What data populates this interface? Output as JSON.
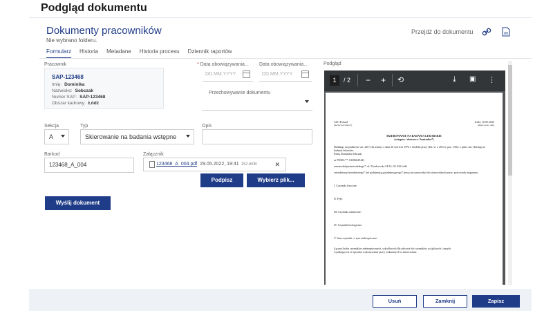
{
  "page": {
    "title": "Podgląd dokumentu"
  },
  "card": {
    "title": "Dokumenty pracowników",
    "subtitle": "Nie wybrano folderu.",
    "goto_label": "Przejdź do dokumentu"
  },
  "tabs": [
    {
      "label": "Formularz",
      "active": true
    },
    {
      "label": "Historia"
    },
    {
      "label": "Metadane"
    },
    {
      "label": "Historia procesu"
    },
    {
      "label": "Dziennik raportów"
    }
  ],
  "form": {
    "employee_label": "Pracownik",
    "employee": {
      "id": "SAP-123468",
      "rows": [
        {
          "label": "Imię:",
          "value": "Dominika"
        },
        {
          "label": "Nazwisko:",
          "value": "Sobczak"
        },
        {
          "label": "Numer SAP:",
          "value": "SAP-123468"
        },
        {
          "label": "Obszar kadrowy:",
          "value": "Łódź"
        }
      ]
    },
    "valid_from_label": "Data obowiązywania...",
    "valid_to_label": "Data obowiązywania...",
    "date_placeholder": "DD.MM.YYYY",
    "storage_label": "Przechowywanie dokumentu",
    "storage_value": "",
    "section_label": "Sekcja",
    "section_value": "A",
    "type_label": "Typ",
    "type_value": "Skierowanie na badania wstępne",
    "desc_label": "Opis",
    "desc_value": "",
    "barcode_label": "Barkod",
    "barcode_value": "123468_A_004",
    "attachment_label": "Załącznik",
    "attachment": {
      "file": "123468_A_004.pdf",
      "date": "29.05.2022, 19:41",
      "size": "152.6KB"
    },
    "sign_label": "Podpisz",
    "choose_file_label": "Wybierz plik...",
    "send_label": "Wyślij dokument"
  },
  "preview": {
    "label": "Podgląd",
    "page_current": "1",
    "page_total": "/ 2",
    "doc": {
      "header_left": "ASC Poland",
      "header_left_sub": "(pieczęć pracodawcy)",
      "header_right": "Łódź, 16.05.2022",
      "header_right_sub": "(miejscowość, data)",
      "title": "SKIEROWANIE NA BADANIA LEKARSKIE",
      "title_sub": "(wstępne / okresowe / kontrolne*)",
      "paragraph": "Działając na podstawie art. 229 § 4a ustawy z dnia 26 czerwca 1974 r. Kodeks pracy (Dz. U. z 2014 r. poz. 1502, z późn. zm.) kieruję na badania lekarskie:",
      "person": "Panią Dominika Sobczak",
      "pesel": "nr PESEL**: 81386045441",
      "address": "zamieszkałą/zamieszkałego*: ul. Piotrkowska 54/14, 02-543 Łódź",
      "position": "zatrudnioną/zatrudnionego* lub podejmującą/podejmującego* pracę na stanowisku lub stanowiskach pracy: pracownik magazynu",
      "sections": [
        "I. Czynniki fizyczne:",
        "II. Pyły:",
        "III. Czynniki chemiczne:",
        "IV. Czynniki biologiczne:",
        "V. Inne czynniki, w tym niebezpieczne:"
      ],
      "summary": "Łączna liczba czynników niebezpiecznych, szkodliwych dla zdrowia lub czynników uciążliwych i innych wynikających ze sposobu wykonywania pracy wskazanych w skierowaniu:"
    }
  },
  "footer": {
    "cancel_label": "Usuń",
    "close_label": "Zamknij",
    "save_label": "Zapisz"
  },
  "colors": {
    "primary": "#1f3c88",
    "footer_bg": "#eef1f6"
  }
}
